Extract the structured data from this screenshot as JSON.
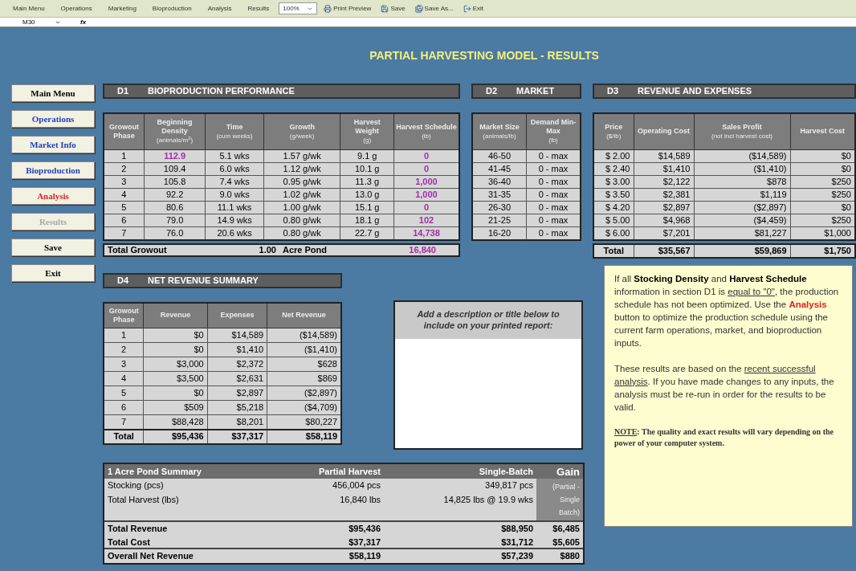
{
  "toolbar": {
    "menus": [
      "Main Menu",
      "Operations",
      "Marketing",
      "Bioproduction",
      "Analysis",
      "Results"
    ],
    "zoom": "100%",
    "buttons": [
      {
        "label": "Print Preview",
        "kind": "preview"
      },
      {
        "label": "Save",
        "kind": "save"
      },
      {
        "label": "Save As...",
        "kind": "saveas"
      },
      {
        "label": "Exit",
        "kind": "exit"
      }
    ]
  },
  "formula_bar": {
    "name_box": "M30",
    "fx": "fx"
  },
  "title": "PARTIAL HARVESTING MODEL - RESULTS",
  "nav": [
    {
      "label": "Main Menu",
      "color": "#000000"
    },
    {
      "label": "Operations",
      "color": "#1f3fbf"
    },
    {
      "label": "Market Info",
      "color": "#1f3fbf"
    },
    {
      "label": "Bioproduction",
      "color": "#1f3fbf"
    },
    {
      "label": "Analysis",
      "color": "#e02020"
    },
    {
      "label": "Results",
      "color": "#a8a8a8"
    },
    {
      "label": "Save",
      "color": "#000000"
    },
    {
      "label": "Exit",
      "color": "#000000"
    }
  ],
  "d1": {
    "code": "D1",
    "title": "BIOPRODUCTION PERFORMANCE",
    "columns": [
      {
        "name": "Growout Phase"
      },
      {
        "name": "Beginning Density",
        "unit": "(animals/m$^{2}$)"
      },
      {
        "name": "Time",
        "unit": "(cum weeks)"
      },
      {
        "name": "Growth",
        "unit": "(g/week)"
      },
      {
        "name": "Harvest Weight",
        "unit": "(g)"
      },
      {
        "name": "Harvest Schedule",
        "unit": "(lb)"
      }
    ],
    "rows": [
      {
        "phase": "1",
        "density": "112.9",
        "highlighted": true,
        "time": "5.1 wks",
        "growth": "1.57 g/wk",
        "weight": "9.1 g",
        "schedule": "0"
      },
      {
        "phase": "2",
        "density": "109.4",
        "highlighted": false,
        "time": "6.0 wks",
        "growth": "1.12 g/wk",
        "weight": "10.1 g",
        "schedule": "0"
      },
      {
        "phase": "3",
        "density": "105.8",
        "highlighted": false,
        "time": "7.4 wks",
        "growth": "0.95 g/wk",
        "weight": "11.3 g",
        "schedule": "1,000"
      },
      {
        "phase": "4",
        "density": "92.2",
        "highlighted": false,
        "time": "9.0 wks",
        "growth": "1.02 g/wk",
        "weight": "13.0 g",
        "schedule": "1,000"
      },
      {
        "phase": "5",
        "density": "80.6",
        "highlighted": false,
        "time": "11.1 wks",
        "growth": "1.00 g/wk",
        "weight": "15.1 g",
        "schedule": "0"
      },
      {
        "phase": "6",
        "density": "79.0",
        "highlighted": false,
        "time": "14.9 wks",
        "growth": "0.80 g/wk",
        "weight": "18.1 g",
        "schedule": "102"
      },
      {
        "phase": "7",
        "density": "76.0",
        "highlighted": false,
        "time": "20.6 wks",
        "growth": "0.80 g/wk",
        "weight": "22.7 g",
        "schedule": "14,738"
      }
    ],
    "total": {
      "label": "Total Growout",
      "value": "1.00",
      "unit": "Acre Pond",
      "schedule": "16,840"
    }
  },
  "d2": {
    "code": "D2",
    "title": "MARKET",
    "columns": [
      {
        "name": "Market Size",
        "unit": "(animals/lb)"
      },
      {
        "name": "Demand Min-Max",
        "unit": "(lb)"
      }
    ],
    "rows": [
      [
        "46-50",
        "0 - max"
      ],
      [
        "41-45",
        "0 - max"
      ],
      [
        "36-40",
        "0 - max"
      ],
      [
        "31-35",
        "0 - max"
      ],
      [
        "26-30",
        "0 - max"
      ],
      [
        "21-25",
        "0 - max"
      ],
      [
        "16-20",
        "0 - max"
      ]
    ]
  },
  "d3": {
    "code": "D3",
    "title": "REVENUE AND EXPENSES",
    "columns": [
      {
        "name": "Price",
        "unit": "($/lb)"
      },
      {
        "name": "Operating Cost"
      },
      {
        "name": "Sales Profit",
        "unit": "(not incl harvest cost)"
      },
      {
        "name": "Harvest Cost"
      }
    ],
    "rows": [
      [
        "$ 2.00",
        "$14,589",
        "($14,589)",
        "$0"
      ],
      [
        "$ 2.40",
        "$1,410",
        "($1,410)",
        "$0"
      ],
      [
        "$ 3.00",
        "$2,122",
        "$878",
        "$250"
      ],
      [
        "$ 3.50",
        "$2,381",
        "$1,119",
        "$250"
      ],
      [
        "$ 4.20",
        "$2,897",
        "($2,897)",
        "$0"
      ],
      [
        "$ 5.00",
        "$4,968",
        "($4,459)",
        "$250"
      ],
      [
        "$ 6.00",
        "$7,201",
        "$81,227",
        "$1,000"
      ]
    ],
    "total": [
      "Total",
      "$35,567",
      "$59,869",
      "$1,750"
    ]
  },
  "d4": {
    "code": "D4",
    "title": "NET REVENUE SUMMARY",
    "columns": [
      "Growout Phase",
      "Revenue",
      "Expenses",
      "Net Revenue"
    ],
    "rows": [
      [
        "1",
        "$0",
        "$14,589",
        "($14,589)"
      ],
      [
        "2",
        "$0",
        "$1,410",
        "($1,410)"
      ],
      [
        "3",
        "$3,000",
        "$2,372",
        "$628"
      ],
      [
        "4",
        "$3,500",
        "$2,631",
        "$869"
      ],
      [
        "5",
        "$0",
        "$2,897",
        "($2,897)"
      ],
      [
        "6",
        "$509",
        "$5,218",
        "($4,709)"
      ],
      [
        "7",
        "$88,428",
        "$8,201",
        "$80,227"
      ]
    ],
    "total": [
      "Total",
      "$95,436",
      "$37,317",
      "$58,119"
    ]
  },
  "description": {
    "prompt": "Add a description or title below to include on your printed report:"
  },
  "note": {
    "paragraphs": [
      [
        {
          "kind": "text",
          "text": "If all "
        },
        {
          "kind": "bold",
          "text": "Stocking Density"
        },
        {
          "kind": "text",
          "text": " and "
        },
        {
          "kind": "bold",
          "text": "Harvest Schedule"
        },
        {
          "kind": "text",
          "text": " information in section D1 is "
        },
        {
          "kind": "underline",
          "text": "equal to \"0\""
        },
        {
          "kind": "text",
          "text": ", the production schedule has not been optimized.   Use the "
        },
        {
          "kind": "alert",
          "text": "Analysis"
        },
        {
          "kind": "text",
          "text": " button to optimize the production schedule using the current farm operations, market, and bioproduction inputs."
        }
      ],
      [
        {
          "kind": "text",
          "text": "These results are based on the "
        },
        {
          "kind": "underline",
          "text": "recent successful analysis"
        },
        {
          "kind": "text",
          "text": ".  If you have made changes to any inputs, the analysis must be re-run in order for the results to be valid."
        }
      ]
    ],
    "footnote": [
      {
        "kind": "underline",
        "text": "NOTE"
      },
      {
        "kind": "text",
        "text": ":  The quality and exact results will vary depending on the power of your computer system."
      }
    ]
  },
  "summary": {
    "columns": [
      "1 Acre Pond Summary",
      "Partial Harvest",
      "Single-Batch",
      "Gain"
    ],
    "gain_note": "(Partial - Single Batch)",
    "rows": [
      {
        "label": "Stocking (pcs)",
        "partial": "456,004 pcs",
        "single": "349,817 pcs",
        "bold": false
      },
      {
        "label": "Total Harvest (lbs)",
        "partial": "16,840 lbs",
        "single": "14,825 lbs @ 19.9 wks",
        "bold": false
      },
      {
        "label": "Total Revenue",
        "partial": "$95,436",
        "single": "$88,950",
        "gain": "$6,485",
        "bold": true
      },
      {
        "label": "Total Cost",
        "partial": "$37,317",
        "single": "$31,712",
        "gain": "$5,605",
        "bold": true
      },
      {
        "label": "Overall Net Revenue",
        "partial": "$58,119",
        "single": "$57,239",
        "gain": "$880",
        "bold": true
      }
    ]
  }
}
